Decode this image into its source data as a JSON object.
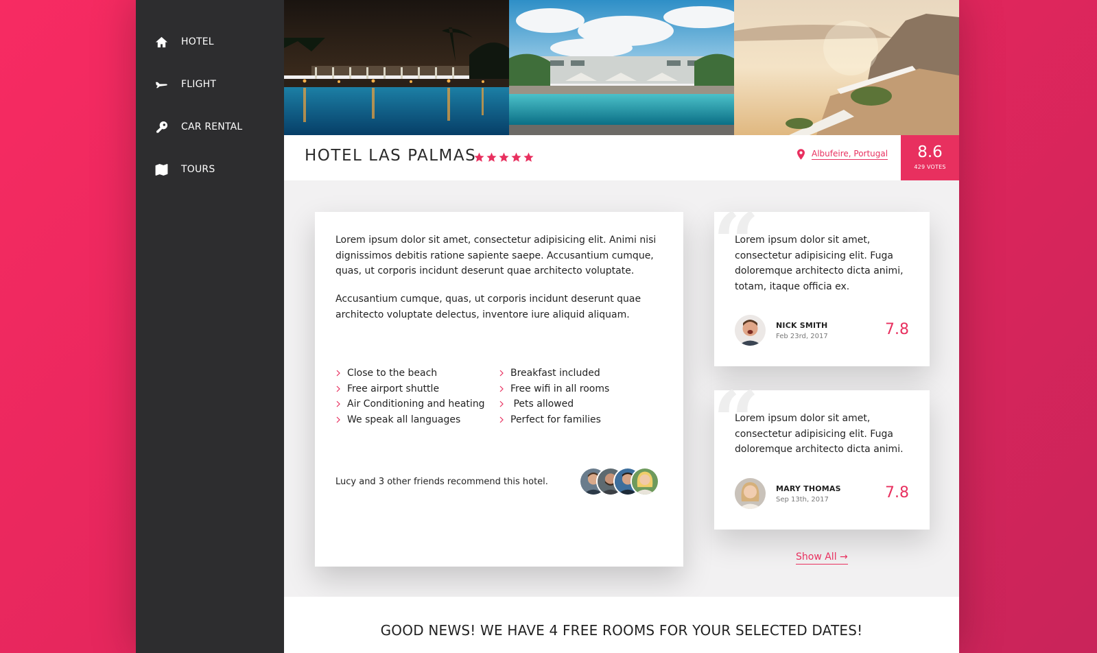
{
  "nav": {
    "items": [
      {
        "label": "HOTEL",
        "icon": "home-icon"
      },
      {
        "label": "FLIGHT",
        "icon": "airplane-icon"
      },
      {
        "label": "CAR RENTAL",
        "icon": "key-icon"
      },
      {
        "label": "TOURS",
        "icon": "map-icon"
      }
    ]
  },
  "hotel": {
    "name": "HOTEL LAS PALMAS",
    "stars": 5,
    "location": "Albufeire, Portugal",
    "rating": "8.6",
    "votes": "429 VOTES"
  },
  "description": {
    "paragraph1": "Lorem ipsum dolor sit amet, consectetur adipisicing elit. Animi nisi dignissimos debitis ratione sapiente saepe. Accusantium cumque, quas, ut corporis incidunt deserunt quae architecto voluptate.",
    "paragraph2": "Accusantium cumque, quas, ut corporis incidunt deserunt quae architecto voluptate delectus, inventore iure aliquid aliquam."
  },
  "features": [
    "Close to the beach",
    "Breakfast included",
    "Free airport shuttle",
    "Free wifi in all rooms",
    "Air Conditioning and heating",
    " Pets allowed",
    "We speak all languages",
    "Perfect for families"
  ],
  "recommend": {
    "text": "Lucy and 3 other friends recommend this hotel."
  },
  "reviews": [
    {
      "text": "Lorem ipsum dolor sit amet, consectetur adipisicing elit. Fuga doloremque architecto dicta animi, totam, itaque officia ex.",
      "name": "NICK SMITH",
      "date": "Feb 23rd, 2017",
      "score": "7.8"
    },
    {
      "text": "Lorem ipsum dolor sit amet, consectetur adipisicing elit. Fuga doloremque architecto dicta animi.",
      "name": "MARY THOMAS",
      "date": "Sep 13th, 2017",
      "score": "7.8"
    }
  ],
  "show_all": "Show All  →",
  "banner": "GOOD NEWS! WE HAVE 4 FREE ROOMS FOR YOUR SELECTED DATES!",
  "colors": {
    "accent": "#e8305f",
    "sidebar": "#2d2d2f",
    "background_gradient_start": "#f72b62",
    "background_gradient_end": "#c9245a"
  }
}
